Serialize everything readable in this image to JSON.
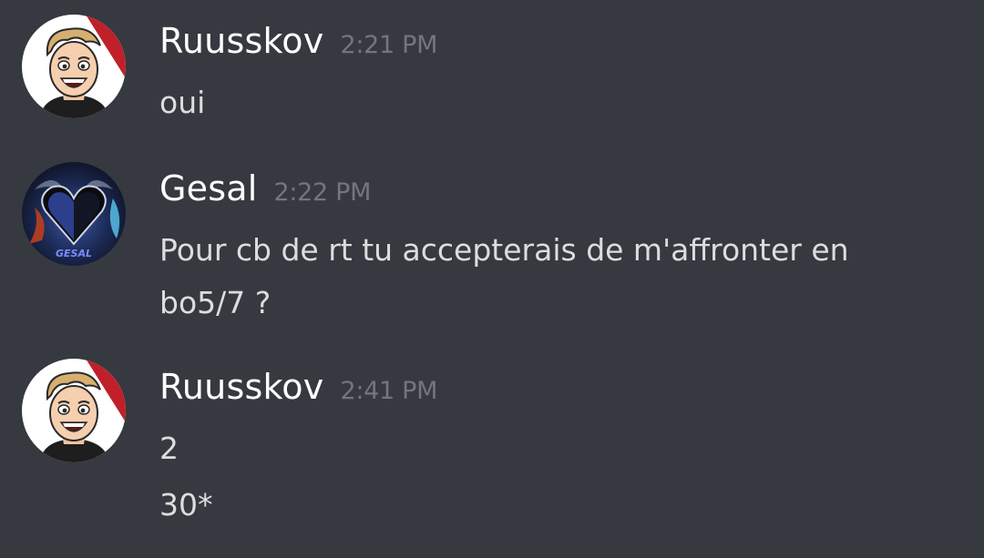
{
  "messages": [
    {
      "author": "Ruusskov",
      "time": "2:21 PM",
      "avatar_icon": "cartoon-face-avatar",
      "lines": [
        "oui"
      ]
    },
    {
      "author": "Gesal",
      "time": "2:22 PM",
      "avatar_icon": "dark-heart-avatar",
      "avatar_text": "GESAL",
      "lines": [
        "Pour cb de rt tu accepterais de m'affronter en",
        "bo5/7 ?"
      ]
    },
    {
      "author": "Ruusskov",
      "time": "2:41 PM",
      "avatar_icon": "cartoon-face-avatar",
      "lines": [
        "2",
        "30*"
      ]
    }
  ],
  "colors": {
    "background": "#36393f",
    "username": "#ffffff",
    "timestamp": "#72767d",
    "message_text": "#dcddde"
  }
}
